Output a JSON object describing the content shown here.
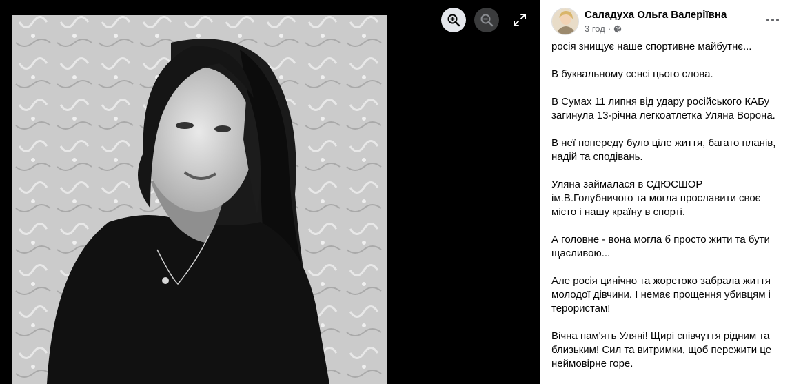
{
  "post": {
    "author": "Саладуха Ольга Валеріївна",
    "time": "3 год",
    "privacy_icon": "globe-icon",
    "more_icon": "more-horizontal-icon",
    "paragraphs": [
      "росія знищує наше спортивне майбутнє...",
      "В буквальному сенсі цього слова.",
      "В Сумах 11 липня від удару російського КАБу загинула 13-річна легкоатлетка Уляна Ворона.",
      "В неї попереду було ціле життя, багато планів, надій та сподівань.",
      "Уляна займалася в СДЮСШОР ім.В.Голубничого та могла прославити своє місто і нашу країну в спорті.",
      "А головне - вона могла б просто жити та бути щасливою...",
      "Але росія цинічно та жорстоко забрала життя молодої дівчини. І немає прощення убивцям і терористам!",
      "Вічна пам'ять Уляні! Щирі співчуття рідним та близьким! Сил та витримки, щоб пережити це неймовірне горе."
    ]
  },
  "viewer": {
    "photo": "black-and-white portrait photo",
    "zoom_in_icon": "zoom-in-icon",
    "zoom_out_icon": "zoom-out-icon",
    "expand_icon": "expand-icon"
  },
  "colors": {
    "viewer_bg": "#000000",
    "panel_bg": "#ffffff",
    "text": "#050505",
    "secondary_text": "#65676b"
  }
}
